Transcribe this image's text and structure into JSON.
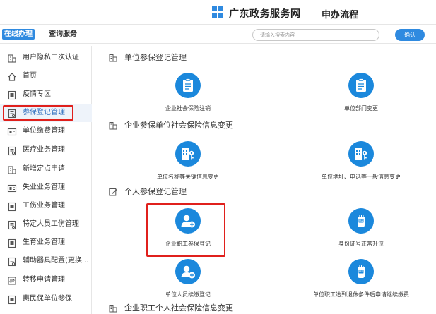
{
  "header": {
    "site_name": "广东政务服务网",
    "section_name": "申办流程"
  },
  "nav": {
    "tab_online": "在线办理",
    "tab_query": "查询服务",
    "search_placeholder": "请输入搜索内容",
    "confirm_label": "确认"
  },
  "sidebar": {
    "items": [
      {
        "label": "用户隐私二次认证",
        "icon": "building-icon"
      },
      {
        "label": "首页",
        "icon": "home-icon"
      },
      {
        "label": "疫情专区",
        "icon": "document-icon"
      },
      {
        "label": "参保登记管理",
        "icon": "form-icon",
        "active": true
      },
      {
        "label": "单位缴费管理",
        "icon": "card-icon"
      },
      {
        "label": "医疗业务管理",
        "icon": "form-icon"
      },
      {
        "label": "新增定点申请",
        "icon": "building-icon"
      },
      {
        "label": "失业业务管理",
        "icon": "card-icon"
      },
      {
        "label": "工伤业务管理",
        "icon": "document-icon"
      },
      {
        "label": "特定人员工伤管理",
        "icon": "form-icon"
      },
      {
        "label": "生育业务管理",
        "icon": "document-icon"
      },
      {
        "label": "辅助器具配置(更换...",
        "icon": "form-icon"
      },
      {
        "label": "转移申请管理",
        "icon": "transfer-icon"
      },
      {
        "label": "惠民保单位参保",
        "icon": "document-icon"
      }
    ]
  },
  "main": {
    "sections": [
      {
        "title": "单位参保登记管理"
      },
      {
        "title": "企业参保单位社会保险信息变更"
      },
      {
        "title": "个人参保登记管理"
      },
      {
        "title": "企业职工个人社会保险信息变更"
      }
    ],
    "services": [
      {
        "label": "企业社会保险注销",
        "icon": "clipboard-icon"
      },
      {
        "label": "单位部门变更",
        "icon": "clipboard-icon"
      },
      {
        "label": "单位名称等关键信息变更",
        "icon": "building-key-icon"
      },
      {
        "label": "单位地址、电话等一般信息变更",
        "icon": "building-key-icon"
      },
      {
        "label": "企业职工参保登记",
        "icon": "user-add-icon"
      },
      {
        "label": "身份证号正常升位",
        "icon": "hand-card-icon"
      },
      {
        "label": "单位人员续缴登记",
        "icon": "user-add-icon"
      },
      {
        "label": "单位职工达到退休条件后申请继续缴费",
        "icon": "hand-card-icon"
      }
    ]
  },
  "colors": {
    "accent": "#2f8ae0",
    "icon_circle": "#1b88dc",
    "highlight_red": "#e0201c"
  }
}
